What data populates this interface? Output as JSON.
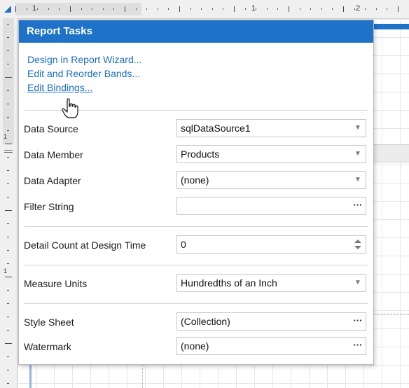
{
  "ruler": {
    "top_numbers": [
      "1",
      "1",
      "2"
    ],
    "left_numbers": [
      "1",
      "1"
    ]
  },
  "panel": {
    "title": "Report Tasks",
    "links": [
      {
        "label": "Design in Report Wizard..."
      },
      {
        "label": "Edit and Reorder Bands..."
      },
      {
        "label": "Edit Bindings..."
      }
    ],
    "properties": {
      "data_source": {
        "label": "Data Source",
        "value": "sqlDataSource1"
      },
      "data_member": {
        "label": "Data Member",
        "value": "Products"
      },
      "data_adapter": {
        "label": "Data Adapter",
        "value": "(none)"
      },
      "filter_string": {
        "label": "Filter String",
        "value": "",
        "button": "···"
      },
      "detail_count": {
        "label": "Detail Count at Design Time",
        "value": "0"
      },
      "measure_units": {
        "label": "Measure Units",
        "value": "Hundredths of an Inch"
      },
      "style_sheet": {
        "label": "Style Sheet",
        "value": "(Collection)",
        "button": "···"
      },
      "watermark": {
        "label": "Watermark",
        "value": "(none)",
        "button": "···"
      }
    }
  },
  "colors": {
    "accent": "#1e73c8",
    "link": "#1e6fc4"
  },
  "icons": {
    "dropdown": "chevron-down-icon",
    "ellipsis": "ellipsis-icon",
    "spinner": "spin-icon",
    "cursor": "hand-pointer-icon"
  }
}
